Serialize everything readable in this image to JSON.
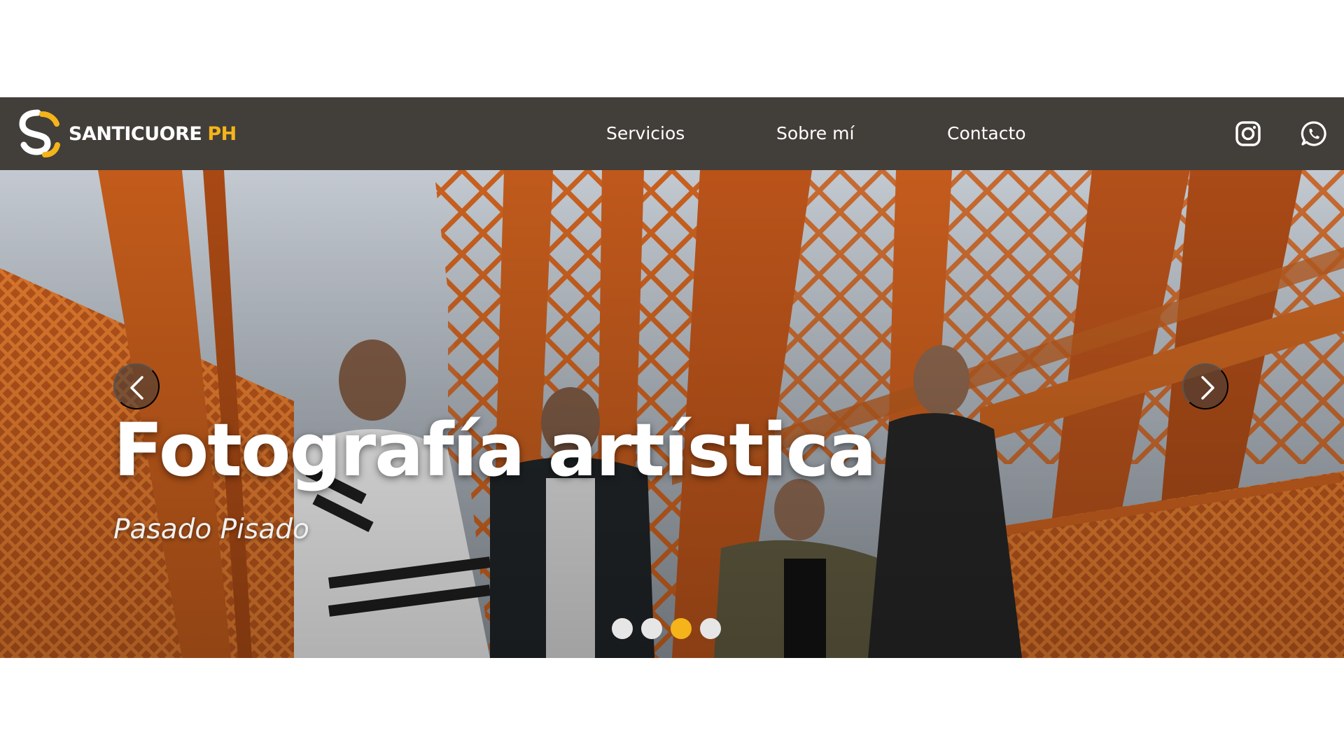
{
  "brand": {
    "name": "SANTICUORE",
    "suffix": "PH",
    "accent": "#f4b41a",
    "logo_icon": "sc-monogram-icon"
  },
  "nav": {
    "links": [
      {
        "label": "Servicios"
      },
      {
        "label": "Sobre mí"
      },
      {
        "label": "Contacto"
      }
    ],
    "social": [
      {
        "name": "instagram-icon"
      },
      {
        "name": "whatsapp-icon"
      }
    ],
    "background": "#423e3a"
  },
  "hero": {
    "title": "Fotografía artística",
    "subtitle": "Pasado Pisado",
    "prev_icon": "chevron-left-icon",
    "next_icon": "chevron-right-icon",
    "slides_total": 4,
    "active_slide": 3
  }
}
